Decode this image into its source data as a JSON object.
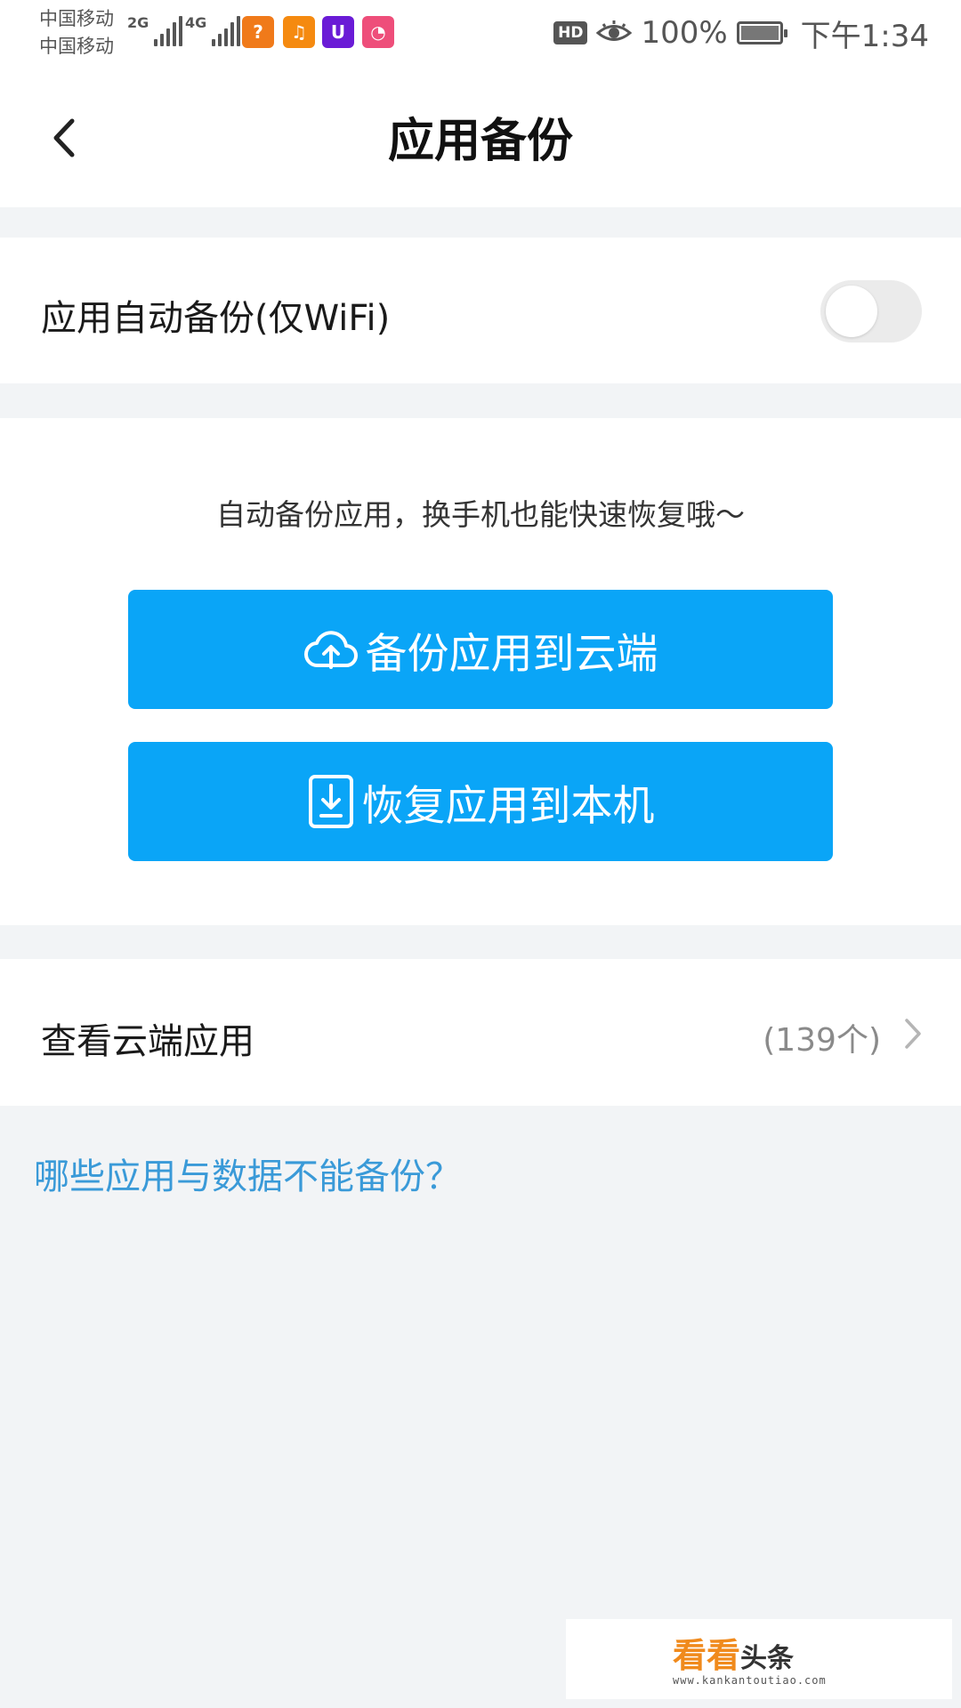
{
  "status_bar": {
    "carrier_1": "中国移动",
    "carrier_2": "中国移动",
    "signal_1_label": "2G",
    "signal_2_label": "4G",
    "hd_label": "HD",
    "battery": "100%",
    "time": "下午1:34",
    "app_icons": [
      "tap-app-icon",
      "kuaishou-icon",
      "u-app-icon",
      "pink-app-icon"
    ]
  },
  "header": {
    "title": "应用备份",
    "back_icon": "chevron-left-icon"
  },
  "auto_backup": {
    "label": "应用自动备份(仅WiFi)",
    "enabled": false
  },
  "backup_panel": {
    "description": "自动备份应用，换手机也能快速恢复哦～",
    "backup_button": "备份应用到云端",
    "restore_button": "恢复应用到本机",
    "accent_color": "#0aa5f7"
  },
  "cloud_apps": {
    "label": "查看云端应用",
    "count": "(139个)"
  },
  "faq_link": "哪些应用与数据不能备份？",
  "watermark": {
    "brand_a": "看看",
    "brand_b": "头条",
    "url": "www.kankantoutiao.com"
  }
}
